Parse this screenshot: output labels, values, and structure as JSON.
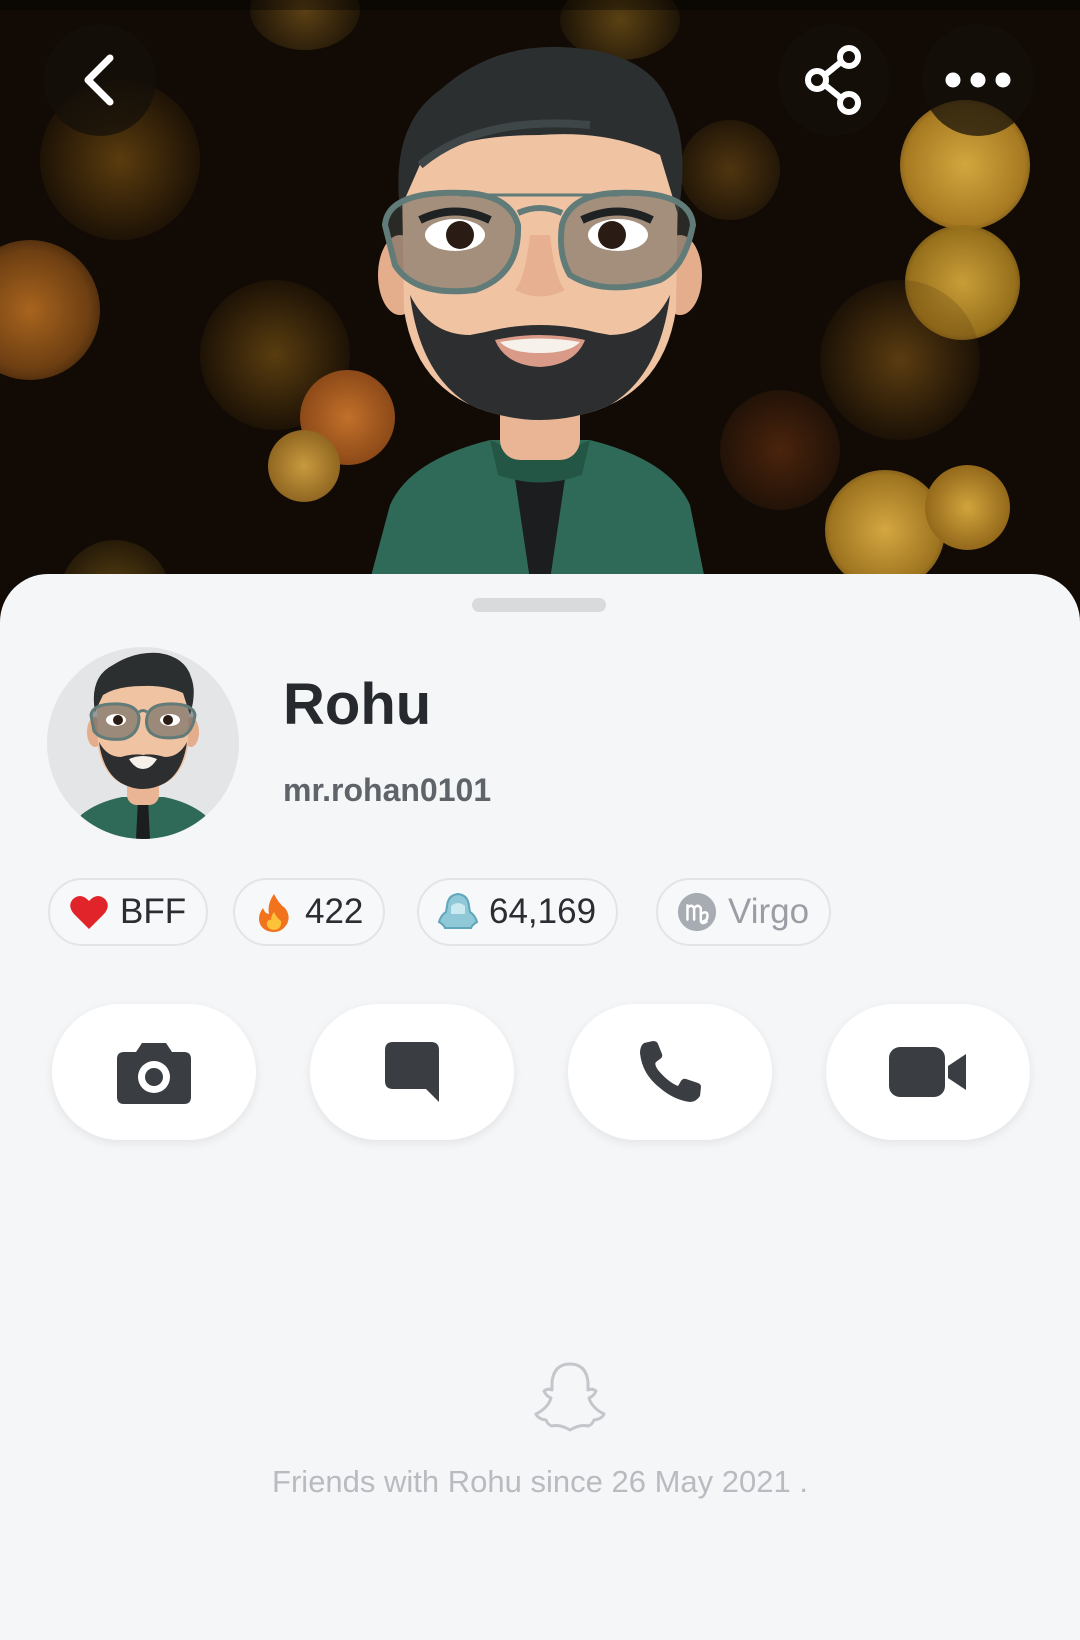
{
  "header": {
    "back_icon": "chevron-left-icon",
    "share_icon": "share-icon",
    "more_icon": "more-dots-icon",
    "bitmoji": "bitmoji-avatar"
  },
  "profile": {
    "display_name": "Rohu",
    "username": "mr.rohan0101",
    "avatar": "bitmoji-avatar"
  },
  "badges": [
    {
      "icon": "red-heart-icon",
      "label": "BFF"
    },
    {
      "icon": "fire-icon",
      "label": "422"
    },
    {
      "icon": "snap-score-icon",
      "label": "64,169"
    },
    {
      "icon": "virgo-zodiac-icon",
      "label": "Virgo"
    }
  ],
  "actions": [
    {
      "icon": "camera-icon"
    },
    {
      "icon": "chat-icon"
    },
    {
      "icon": "phone-icon"
    },
    {
      "icon": "video-call-icon"
    }
  ],
  "friendship": {
    "ghost_icon": "snapchat-ghost-icon",
    "text": "Friends with Rohu since 26 May 2021 ."
  },
  "colors": {
    "sheet_background": "#f5f6f8",
    "primary_text": "#26292d",
    "secondary_text": "#5f646b",
    "icon_dark": "#3a3d42",
    "muted_text": "#b8bbc0"
  }
}
